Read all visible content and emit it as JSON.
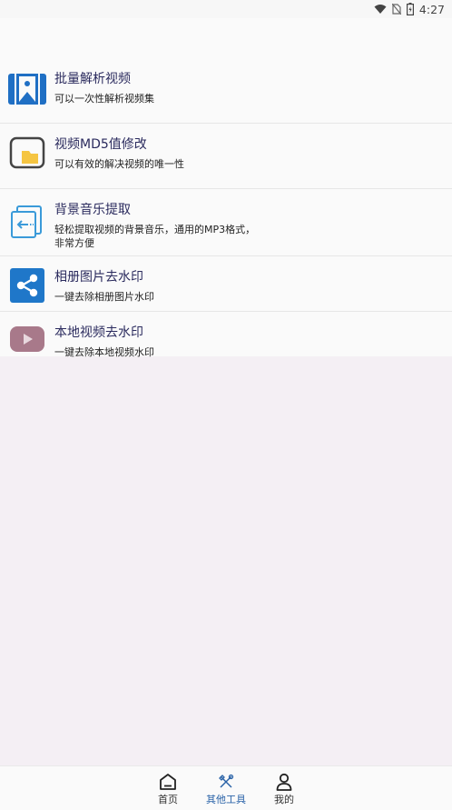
{
  "status_bar": {
    "time": "4:27",
    "icons": [
      "wifi-icon",
      "no-sim-icon",
      "battery-icon"
    ]
  },
  "tools": [
    {
      "title": "批量解析视频",
      "desc": "可以一次性解析视频集",
      "icon": "picture-frame-icon",
      "color": "#1f6fc4"
    },
    {
      "title": "视频MD5值修改",
      "desc": "可以有效的解决视频的唯一性",
      "icon": "folder-icon",
      "color": "#f5c542"
    },
    {
      "title": "背景音乐提取",
      "desc": "轻松提取视频的背景音乐，通用的MP3格式，",
      "desc2": "非常方便",
      "icon": "extract-icon",
      "color": "#3a9ad9"
    },
    {
      "title": "相册图片去水印",
      "desc": "一键去除相册图片水印",
      "icon": "share-icon",
      "color": "#1f77c9"
    },
    {
      "title": "本地视频去水印",
      "desc": "一键去除本地视频水印",
      "icon": "play-icon",
      "color": "#a8798a"
    }
  ],
  "bottom_nav": {
    "items": [
      {
        "label": "首页",
        "icon": "home-icon",
        "active": false
      },
      {
        "label": "其他工具",
        "icon": "tools-icon",
        "active": true
      },
      {
        "label": "我的",
        "icon": "user-icon",
        "active": false
      }
    ],
    "active_color": "#2a63a8"
  }
}
